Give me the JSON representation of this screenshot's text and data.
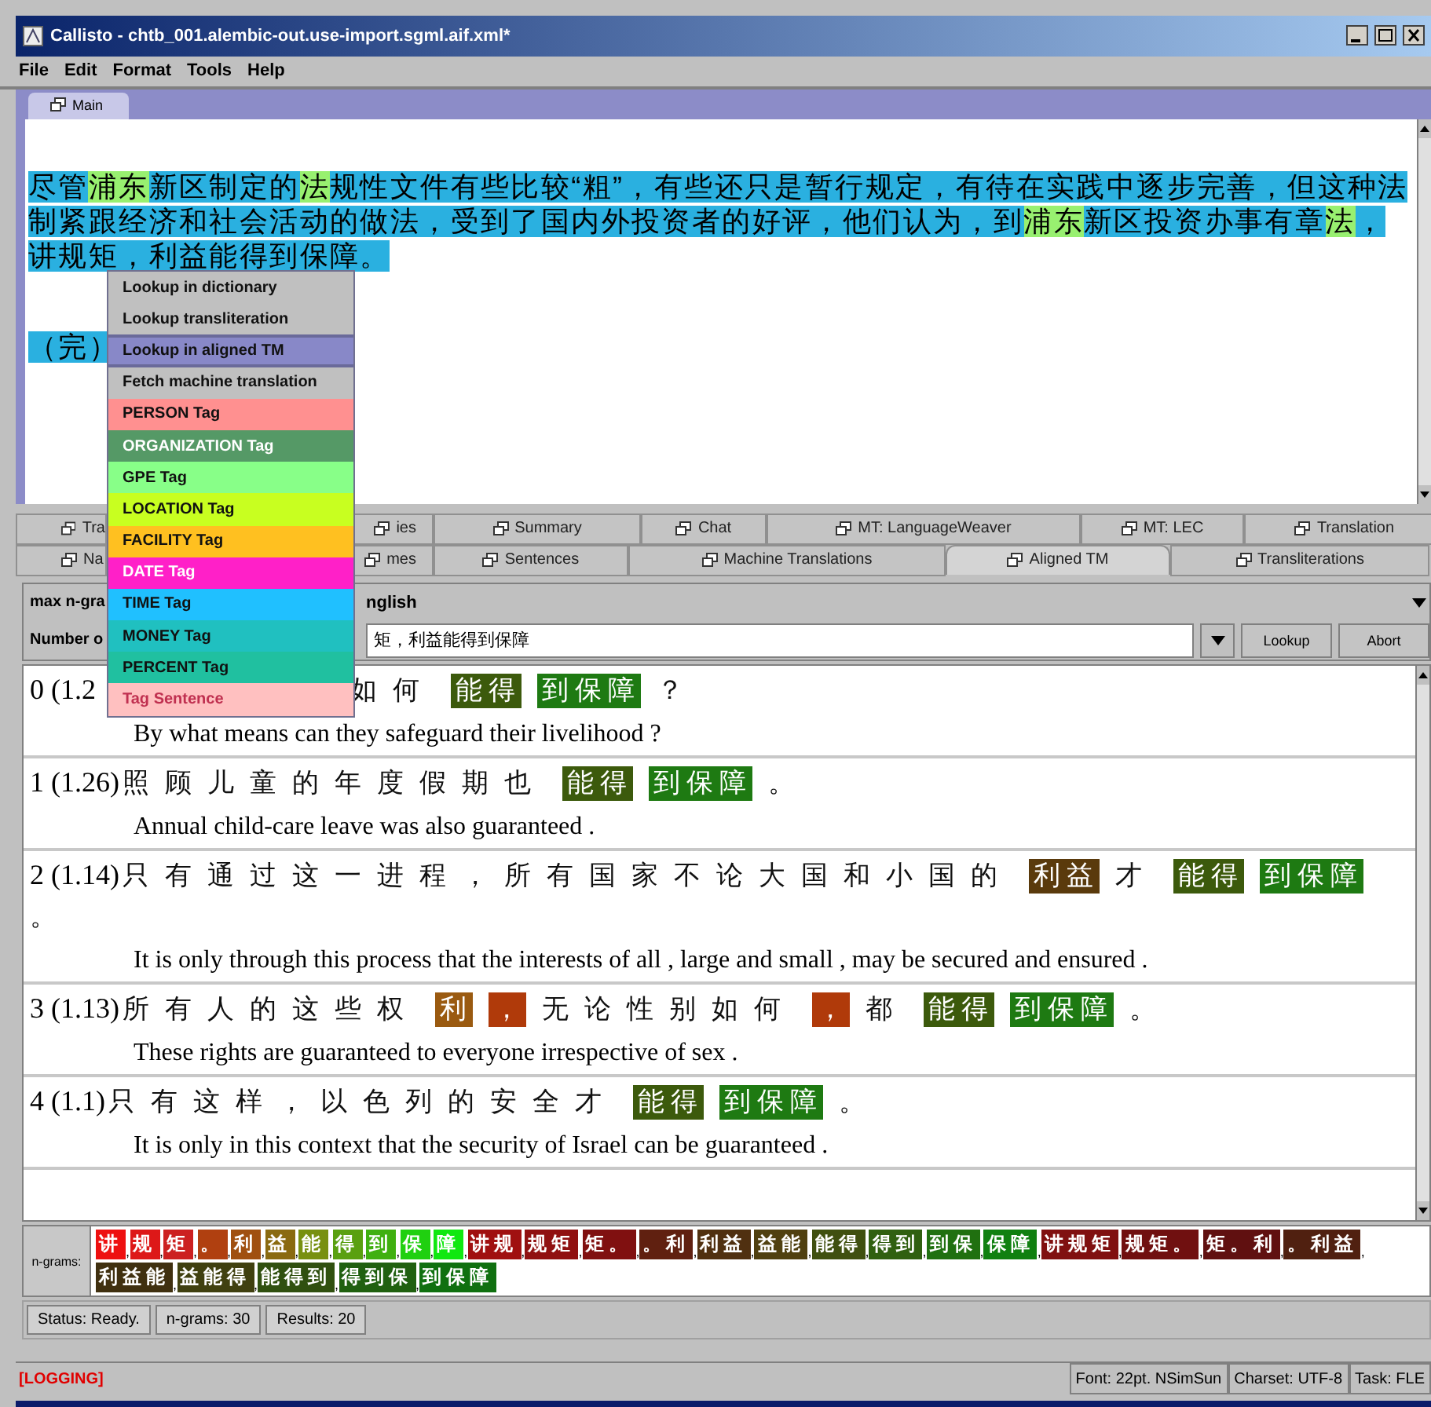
{
  "window": {
    "title": "Callisto - chtb_001.alembic-out.use-import.sgml.aif.xml*"
  },
  "menu_bar": [
    "File",
    "Edit",
    "Format",
    "Tools",
    "Help"
  ],
  "document_tabs": [
    {
      "label": "Main",
      "selected": true
    }
  ],
  "document": {
    "paragraphs": [
      [
        {
          "text": "尽管",
          "highlighted": false
        },
        {
          "text": "浦东",
          "highlighted": true
        },
        {
          "text": "新区制定的",
          "highlighted": false
        },
        {
          "text": "法",
          "highlighted": true
        },
        {
          "text": "规性文件有些比较“粗”，有些还只是暂行规定，有待在实践中逐步完善，但这种法制紧跟经济和社会活动的做法，受到了国内外投资者的好评，他们认为，到",
          "highlighted": false
        },
        {
          "text": "浦东",
          "highlighted": true
        },
        {
          "text": "新区投资办事有章",
          "highlighted": false
        },
        {
          "text": "法",
          "highlighted": true
        },
        {
          "text": "，讲规矩，利益能得到保障。",
          "highlighted": false
        }
      ],
      [
        {
          "text": "（完）",
          "highlighted": false
        }
      ]
    ]
  },
  "context_menu": [
    {
      "label": "Lookup in dictionary",
      "selected": false,
      "color": "#c0c0c0"
    },
    {
      "label": "Lookup transliteration",
      "selected": false,
      "color": "#c0c0c0"
    },
    {
      "label": "Lookup in aligned TM",
      "selected": true,
      "color": "#8888c8"
    },
    {
      "label": "Fetch machine translation",
      "selected": false,
      "color": "#c0c0c0"
    },
    {
      "label": "PERSON Tag",
      "selected": false,
      "color": "#ff9090"
    },
    {
      "label": "ORGANIZATION Tag",
      "selected": false,
      "color": "#559966"
    },
    {
      "label": "GPE Tag",
      "selected": false,
      "color": "#88ff88"
    },
    {
      "label": "LOCATION Tag",
      "selected": false,
      "color": "#c8ff20"
    },
    {
      "label": "FACILITY Tag",
      "selected": false,
      "color": "#ffc020"
    },
    {
      "label": "DATE Tag",
      "selected": false,
      "color": "#ff20c8"
    },
    {
      "label": "TIME Tag",
      "selected": false,
      "color": "#20c0ff"
    },
    {
      "label": "MONEY Tag",
      "selected": false,
      "color": "#20c0c0"
    },
    {
      "label": "PERCENT Tag",
      "selected": false,
      "color": "#20c0a0"
    },
    {
      "label": "Tag Sentence",
      "selected": false,
      "color": "#ffc0c0"
    }
  ],
  "panel_tabs": [
    [
      {
        "label": "Tra",
        "selected": false
      },
      {
        "label": "ies",
        "selected": false
      },
      {
        "label": "Summary",
        "selected": false
      },
      {
        "label": "Chat",
        "selected": false
      },
      {
        "label": "MT: LanguageWeaver",
        "selected": false
      },
      {
        "label": "MT: LEC",
        "selected": false
      },
      {
        "label": "Translation",
        "selected": false
      }
    ],
    [
      {
        "label": "Na",
        "selected": false
      },
      {
        "label": "mes",
        "selected": false
      },
      {
        "label": "Sentences",
        "selected": false
      },
      {
        "label": "Machine Translations",
        "selected": false
      },
      {
        "label": "Aligned TM",
        "selected": true
      },
      {
        "label": "Transliterations",
        "selected": false
      }
    ]
  ],
  "controls": {
    "max_ngram_label": "max n-gra",
    "language": "nglish",
    "number_label": "Number o",
    "query": "矩，利益能得到保障",
    "buttons": [
      "Lookup",
      "Abort"
    ]
  },
  "results": [
    {
      "score": "0 (1.2",
      "covered": true,
      "tokens": [
        {
          "text": "如何"
        },
        {
          "text": "能得",
          "color": "#3c5a0c"
        },
        {
          "text": "到保障",
          "color": "#1e7a12"
        },
        {
          "text": "？"
        }
      ],
      "translation": "By what means can they safeguard their livelihood ?"
    },
    {
      "score": "1 (1.26)",
      "covered": false,
      "tokens": [
        {
          "text": "照顾儿童的年度假期也"
        },
        {
          "text": "能得",
          "color": "#3c5a0c"
        },
        {
          "text": "到保障",
          "color": "#1e7a12"
        },
        {
          "text": "。"
        }
      ],
      "translation": "Annual child-care leave was also guaranteed ."
    },
    {
      "score": "2 (1.14)",
      "covered": false,
      "tokens": [
        {
          "text": "只有通过这一进程，所有国家不论大国和小国的"
        },
        {
          "text": "利益",
          "color": "#5a3a0c"
        },
        {
          "text": "才"
        },
        {
          "text": "能得",
          "color": "#3c5a0c"
        },
        {
          "text": "到保障",
          "color": "#1e7a12"
        },
        {
          "text": "。"
        }
      ],
      "translation": "It is only through this process that the interests of all , large and small , may be secured and ensured ."
    },
    {
      "score": "3 (1.13)",
      "covered": false,
      "tokens": [
        {
          "text": "所有人的这些权"
        },
        {
          "text": "利",
          "color": "#9a5a10"
        },
        {
          "text": "，",
          "color": "#b03a0a"
        },
        {
          "text": "无论性别如何"
        },
        {
          "text": "，",
          "color": "#b03a0a"
        },
        {
          "text": "都"
        },
        {
          "text": "能得",
          "color": "#3c5a0c"
        },
        {
          "text": "到保障",
          "color": "#1e7a12"
        },
        {
          "text": "。"
        }
      ],
      "translation": "These rights are guaranteed to everyone irrespective of sex ."
    },
    {
      "score": "4 (1.1)",
      "covered": false,
      "tokens": [
        {
          "text": "只有这样，以色列的安全才"
        },
        {
          "text": "能得",
          "color": "#3c5a0c"
        },
        {
          "text": "到保障",
          "color": "#1e7a12"
        },
        {
          "text": "。"
        }
      ],
      "translation": "It is only in this context that the security of Israel can be guaranteed ."
    }
  ],
  "ngrams": {
    "label": "n-grams:",
    "separator": ",",
    "items": [
      {
        "text": "讲",
        "color": "#ee1010"
      },
      {
        "text": "规",
        "color": "#dd1818"
      },
      {
        "text": "矩",
        "color": "#cc2020"
      },
      {
        "text": "。",
        "color": "#b04010"
      },
      {
        "text": "利",
        "color": "#a05010"
      },
      {
        "text": "益",
        "color": "#8a6a10"
      },
      {
        "text": "能",
        "color": "#789010"
      },
      {
        "text": "得",
        "color": "#5aa010"
      },
      {
        "text": "到",
        "color": "#40b010"
      },
      {
        "text": "保",
        "color": "#20d010"
      },
      {
        "text": "障",
        "color": "#10e810"
      },
      {
        "text": "讲规",
        "color": "#a01010"
      },
      {
        "text": "规矩",
        "color": "#901010"
      },
      {
        "text": "矩。",
        "color": "#801010"
      },
      {
        "text": "。利",
        "color": "#602010"
      },
      {
        "text": "利益",
        "color": "#503010"
      },
      {
        "text": "益能",
        "color": "#504010"
      },
      {
        "text": "能得",
        "color": "#405010"
      },
      {
        "text": "得到",
        "color": "#306010"
      },
      {
        "text": "到保",
        "color": "#207010"
      },
      {
        "text": "保障",
        "color": "#108010"
      },
      {
        "text": "讲规矩",
        "color": "#801010"
      },
      {
        "text": "规矩。",
        "color": "#701010"
      },
      {
        "text": "矩。利",
        "color": "#601010"
      },
      {
        "text": "。利益",
        "color": "#502010"
      },
      {
        "text": "利益能",
        "color": "#403010"
      },
      {
        "text": "益能得",
        "color": "#404010"
      },
      {
        "text": "能得到",
        "color": "#305010"
      },
      {
        "text": "得到保",
        "color": "#206010"
      },
      {
        "text": "到保障",
        "color": "#107010"
      }
    ]
  },
  "status": [
    "Status: Ready.",
    "n-grams: 30",
    "Results: 20"
  ],
  "log_bar": {
    "log": "[LOGGING]",
    "fields": [
      "Font: 22pt. NSimSun",
      "Charset: UTF-8",
      "Task: FLE"
    ]
  }
}
